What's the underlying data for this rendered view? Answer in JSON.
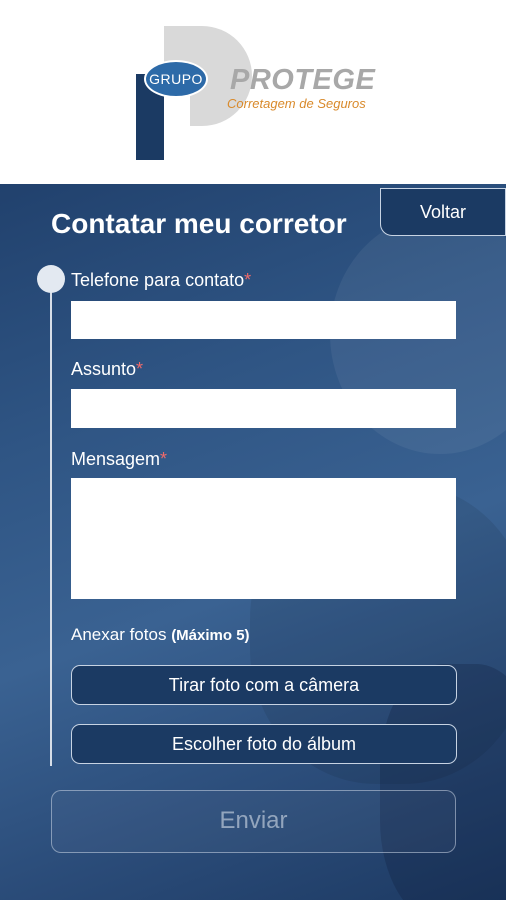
{
  "logo": {
    "grupo": "GRUPO",
    "name": "PROTEGE",
    "subtitle": "Corretagem de Seguros"
  },
  "page": {
    "title": "Contatar meu corretor",
    "back_label": "Voltar"
  },
  "form": {
    "phone_label": "Telefone para contato",
    "phone_value": "",
    "subject_label": "Assunto",
    "subject_value": "",
    "message_label": "Mensagem",
    "message_value": "",
    "required_mark": "*",
    "attach_label": "Anexar fotos",
    "attach_limit": "(Máximo 5)",
    "camera_button": "Tirar foto com a câmera",
    "album_button": "Escolher foto do álbum",
    "send_button": "Enviar"
  },
  "colors": {
    "primary": "#1b3a63",
    "required": "#f06a6a",
    "accent_orange": "#d98a2b"
  }
}
